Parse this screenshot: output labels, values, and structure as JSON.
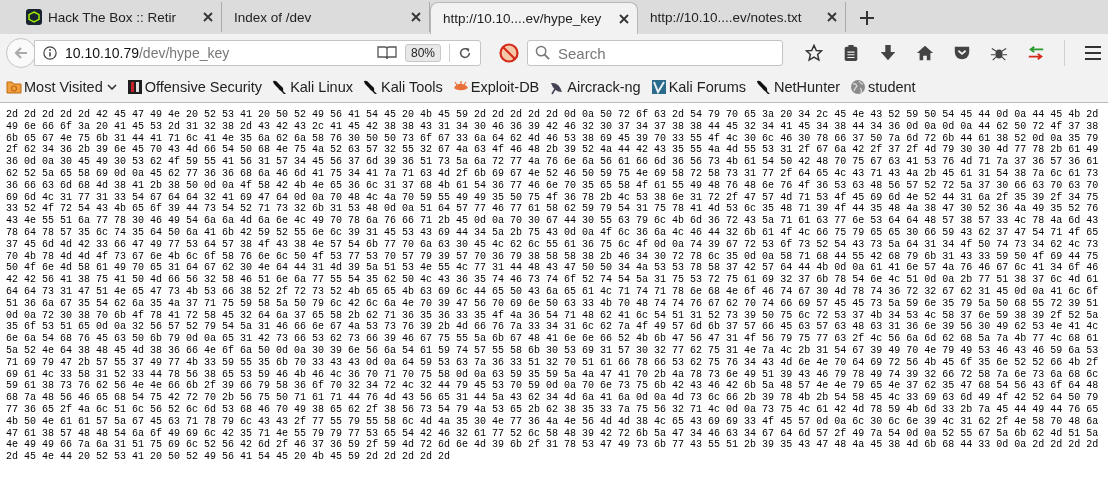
{
  "tabs": [
    {
      "title": "Hack The Box :: Retir",
      "favicon": true,
      "selected": false
    },
    {
      "title": "Index of /dev",
      "favicon": false,
      "selected": false
    },
    {
      "title": "http://10.10....ev/hype_key",
      "favicon": false,
      "selected": true
    },
    {
      "title": "http://10.10....ev/notes.txt",
      "favicon": false,
      "selected": false
    }
  ],
  "address": {
    "host": "10.10.10.79",
    "path": "/dev/hype_key"
  },
  "zoom": "80%",
  "search": {
    "placeholder": "Search"
  },
  "bookmarks": [
    {
      "label": "Most Visited",
      "kind": "folder",
      "dropdown": true
    },
    {
      "label": "Offensive Security",
      "kind": "offsec",
      "dropdown": false
    },
    {
      "label": "Kali Linux",
      "kind": "dragon",
      "dropdown": false
    },
    {
      "label": "Kali Tools",
      "kind": "dragon",
      "dropdown": false
    },
    {
      "label": "Exploit-DB",
      "kind": "exploit",
      "dropdown": false
    },
    {
      "label": "Aircrack-ng",
      "kind": "aircrack",
      "dropdown": false
    },
    {
      "label": "Kali Forums",
      "kind": "forums",
      "dropdown": false
    },
    {
      "label": "NetHunter",
      "kind": "dragon",
      "dropdown": false
    },
    {
      "label": "student",
      "kind": "globe",
      "dropdown": false
    }
  ],
  "hex_lines": [
    "2d 2d 2d 2d 2d 42 45 47 49 4e 20 52 53 41 20 50 52 49 56 41 54 45 20 4b 45 59 2d 2d 2d 2d 2d 0d 0a 50 72 6f 63 2d 54 79 70 65 3a 20 34 2c 45 4e 43 52 59 50 54 45 44 0d 0a 44 45 4b 2d",
    "49 6e 66 6f 3a 20 41 45 53 2d 31 32 38 2d 43 42 43 2c 41 45 42 38 38 43 31 34 30 46 36 39 42 46 32 30 37 34 37 38 38 44 45 32 34 41 45 34 38 44 34 36 0d 0a 0d 0a 44 62 50 72 4f 37 38",
    "6b 65 67 4e 75 6b 31 44 41 71 6c 41 4e 35 6a 62 6a 58 76 30 50 50 73 6f 67 33 6a 64 62 4d 46 53 38 69 45 39 70 33 55 4f 4c 30 6c 46 30 78 66 37 50 7a 6d 72 6b 44 61 38 52 0d 0a 35 79",
    "2f 62 34 36 2b 39 6e 45 70 43 4d 66 54 50 68 4e 75 4a 52 63 57 32 55 32 67 4a 63 4f 46 48 2b 39 52 4a 44 42 43 35 55 4a 4d 55 53 31 2f 67 6a 42 2f 37 2f 4d 79 30 30 4d 77 78 2b 61 49",
    "36 0d 0a 30 45 49 30 53 62 4f 59 55 41 56 31 57 34 45 56 37 6d 39 36 51 73 5a 6a 72 77 4a 76 6e 6a 56 61 66 6d 36 56 73 4b 61 54 50 42 48 70 75 67 63 41 53 76 4d 71 7a 37 36 57 36 61",
    "62 52 5a 65 58 69 0d 0a 45 62 77 36 36 68 6a 46 6d 41 75 34 41 7a 71 63 4d 2f 6b 69 67 4e 52 46 50 59 75 4e 69 58 72 58 73 31 77 2f 64 65 4c 43 71 43 4a 2b 45 61 31 54 38 7a 6c 61 73",
    "36 66 63 6d 68 4d 38 41 2b 38 50 0d 0a 4f 58 42 4b 4e 65 36 6c 31 37 68 4b 61 54 36 77 46 6e 70 35 65 58 4f 61 55 49 48 76 48 6e 76 4f 36 53 63 48 56 57 52 72 5a 37 30 66 63 70 63 70",
    "69 6d 4c 31 77 31 33 54 67 64 64 32 41 69 47 64 0d 0a 70 48 4c 4a 70 59 55 49 49 35 50 75 4f 36 78 2b 4c 53 38 6e 31 72 2f 47 57 4d 71 53 4f 45 69 6d 4e 52 44 31 6a 2f 35 39 2f 34 75",
    "33 52 4f 72 54 43 4b 65 6f 39 44 73 54 52 71 73 32 6b 31 53 48 0d 0a 51 64 57 77 46 77 61 58 62 59 79 54 31 75 78 41 4d 53 6c 35 48 71 39 4f 44 35 48 4a 38 47 30 52 36 4a 49 35 52 76",
    "43 4e 55 51 6a 77 78 30 46 49 54 6a 6a 4d 6a 6e 4c 49 70 78 6a 76 66 71 2b 45 0d 0a 70 30 67 44 30 55 63 79 6c 4b 6d 36 72 43 5a 71 61 63 77 6e 53 64 64 48 57 38 57 33 4c 78 4a 6d 43",
    "78 64 78 57 35 6c 74 35 64 50 6a 41 6b 42 59 52 55 6e 6c 39 31 45 53 43 69 44 34 5a 2b 75 43 0d 0a 4f 6c 36 6a 4c 46 44 32 6b 61 4f 4c 66 75 79 65 65 30 66 59 43 62 37 47 54 71 4f 65",
    "37 45 6d 4d 42 33 66 47 49 77 53 64 57 38 4f 43 38 4e 57 54 6b 77 70 6a 63 30 45 4c 62 6c 55 61 36 75 6c 4f 0d 0a 74 39 67 72 53 6f 73 52 54 43 73 5a 64 31 34 4f 50 74 73 34 62 4c 73",
    "70 4b 78 4d 4d 4f 73 67 6e 4b 6c 6f 58 76 6e 6c 50 4f 53 77 53 70 57 79 39 57 70 36 79 38 58 58 38 2b 46 34 30 72 78 6c 35 0d 0a 58 71 68 44 55 42 68 79 6b 31 43 33 59 50 4f 69 44 75",
    "50 4f 6e 4d 58 61 49 70 65 31 64 67 62 30 4e 64 44 31 4d 39 5a 51 53 4e 55 4c 77 31 44 48 43 47 50 50 34 4a 53 53 78 58 37 42 57 64 44 4b 0d 0a 61 41 6e 57 4a 76 46 67 6c 41 34 6f 46",
    "42 42 56 41 38 75 41 50 4d 66 56 32 58 46 51 6e 6a 77 55 54 35 62 50 4c 43 36 35 74 46 73 74 6f 52 74 54 5a 31 75 53 72 75 61 69 32 37 6b 78 54 6e 4c 51 0d 0a 2b 77 51 38 37 6c 4d 61",
    "64 64 73 31 47 51 4e 65 47 73 4b 53 66 38 52 2f 72 73 52 4b 65 65 4b 63 69 6c 44 65 50 43 6a 65 61 4c 71 74 71 78 6e 68 4e 6f 46 74 67 30 4d 78 74 36 72 32 67 62 31 45 0d 0a 41 6c 6f",
    "51 36 6a 67 35 54 62 6a 35 4a 37 71 75 59 58 5a 50 79 6c 42 6c 6a 4e 70 39 47 56 70 69 6e 50 63 33 4b 70 48 74 74 76 67 62 70 74 66 69 57 45 45 73 5a 59 6e 35 79 5a 50 68 55 72 39 51",
    "0d 0a 72 30 38 70 6b 4f 78 41 72 58 45 32 64 6a 37 65 58 2b 62 71 36 35 36 33 35 4f 4a 36 54 71 48 62 41 6c 54 51 31 52 73 39 50 75 6c 72 53 37 4b 34 53 4c 58 37 6e 59 38 39 2f 52 5a",
    "35 6f 53 51 65 0d 0a 32 56 57 52 79 54 5a 31 46 66 6e 67 4a 53 73 76 39 2b 4d 66 76 7a 33 34 31 6c 62 7a 4f 49 57 6d 6b 37 57 66 45 63 57 63 48 63 31 36 6e 39 56 30 49 62 53 4e 41 4c",
    "6e 6a 54 68 76 45 63 50 6b 79 0d 0a 65 31 42 73 66 53 62 73 66 39 46 67 75 55 5a 6b 67 48 41 6e 6e 66 52 4b 6b 47 56 47 31 4f 56 79 75 77 63 2f 4c 56 6a 6d 62 68 5a 7a 4b 77 4c 68 61",
    "5a 52 4e 64 38 48 45 4d 38 36 66 4e 6f 6a 50 0d 0a 30 39 6e 56 6a 54 61 59 74 57 55 58 6b 30 53 69 31 57 30 32 77 62 75 31 4e 7a 4c 2b 31 54 67 39 49 70 4e 79 49 53 46 43 46 59 6a 53",
    "71 69 79 47 2b 57 55 37 49 77 4b 33 59 55 35 6b 70 33 43 43 0d 0a 64 59 53 63 7a 36 33 51 32 70 51 61 66 78 66 53 62 75 76 34 43 4d 6e 4e 70 64 69 72 56 4b 45 6f 35 6e 52 52 66 4b 2f",
    "69 61 4c 33 58 31 52 33 44 78 56 38 65 53 59 46 4b 46 4c 36 70 71 70 75 58 0d 0a 63 59 35 59 5a 4a 47 41 70 2b 4a 78 73 6e 49 51 39 43 46 79 78 49 74 39 32 66 72 58 7a 6e 73 6a 68 6c",
    "59 61 38 73 76 62 56 4e 4e 66 6b 2f 39 66 79 58 36 6f 70 32 34 72 4c 32 44 79 45 53 70 59 0d 0a 70 6e 73 75 6b 42 43 46 42 6b 5a 48 57 4e 4e 79 65 4e 37 62 35 47 68 54 56 43 6f 64 48",
    "68 7a 48 56 46 65 68 54 75 42 72 70 2b 56 75 50 71 61 71 44 76 4d 43 56 65 31 44 5a 43 62 34 4d 6a 41 6a 0d 0a 4d 73 6c 66 2b 39 78 4b 2b 54 58 45 4c 33 69 63 6d 49 4f 42 52 64 50 79",
    "77 36 65 2f 4a 6c 51 6c 56 52 6c 6d 53 68 46 70 49 38 65 62 2f 38 56 73 54 79 4a 53 65 2b 62 38 35 33 7a 75 56 32 71 4c 0d 0a 73 75 4c 61 42 4d 78 59 4b 6d 33 2b 7a 45 44 49 44 76 65",
    "4b 50 4e 61 61 57 5a 67 45 63 71 78 79 6c 43 43 2f 77 55 79 55 58 6c 4d 4a 35 30 4e 77 36 4a 4e 56 4d 4d 38 4c 65 43 69 69 33 4f 45 57 0d 0a 6c 30 6c 6e 39 4c 31 62 2f 4e 58 70 48 6a",
    "47 61 38 57 48 48 54 6a 6f 49 69 6c 42 35 71 4e 55 79 79 77 53 65 54 42 46 32 61 77 52 6c 58 48 39 42 72 6b 5a 47 34 46 63 34 67 64 6d 57 2f 49 7a 54 0d 0a 52 55 67 5a 6b 62 4d 51 5a",
    "4e 49 49 66 7a 6a 31 51 75 69 6c 52 56 42 6d 2f 46 37 36 59 2f 59 4d 72 6d 6e 4d 39 6b 2f 31 78 53 47 49 73 6b 77 43 55 51 2b 39 35 43 47 48 4a 45 38 4d 6b 68 44 33 0d 0a 2d 2d 2d 2d",
    "2d 45 4e 44 20 52 53 41 20 50 52 49 56 41 54 45 20 4b 45 59 2d 2d 2d 2d 2d"
  ]
}
